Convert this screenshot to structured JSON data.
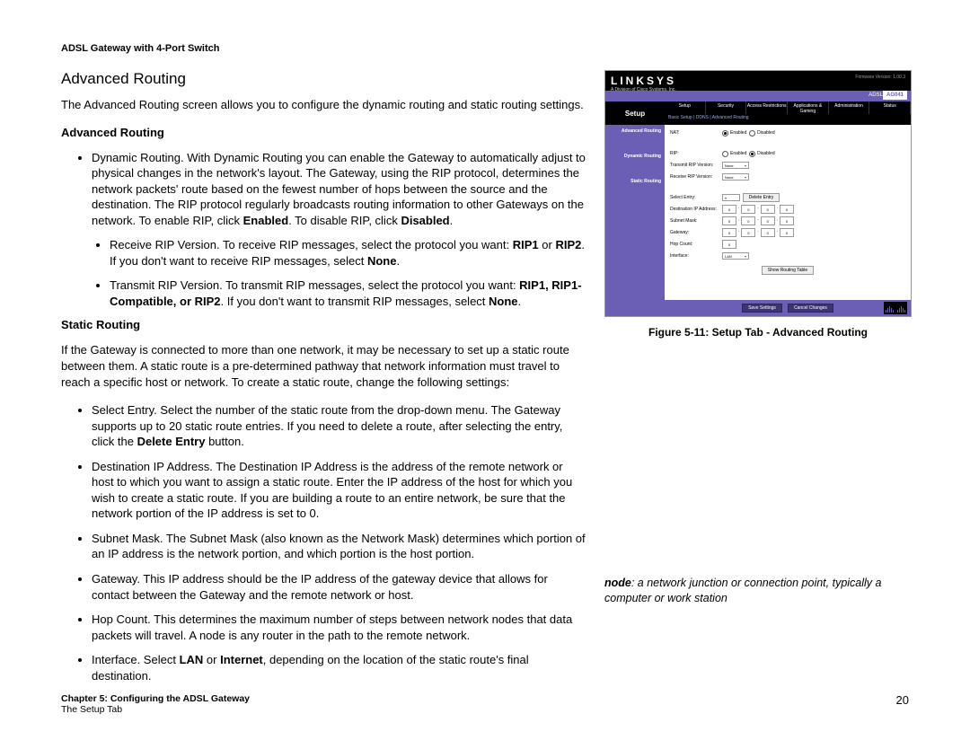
{
  "header": "ADSL Gateway with 4-Port Switch",
  "title": "Advanced Routing",
  "intro": "The Advanced Routing screen allows you to configure the dynamic routing and static routing settings.",
  "section1": {
    "heading": "Advanced Routing",
    "b1_pre": "Dynamic Routing. With Dynamic Routing you can enable the Gateway to automatically adjust to physical changes in the network's layout. The Gateway, using the RIP protocol, determines the network packets' route based on the fewest number of hops between the source and the destination. The RIP protocol regularly broadcasts routing information to other Gateways on the network. To enable RIP, click ",
    "b1_bold1": "Enabled",
    "b1_mid": ". To disable RIP, click ",
    "b1_bold2": "Disabled",
    "b1_end": ".",
    "b2_pre": "Receive RIP Version. To receive RIP messages, select the protocol you want: ",
    "b2_bold1": "RIP1",
    "b2_mid1": " or ",
    "b2_bold2": "RIP2",
    "b2_mid2": ". If you don't want to receive RIP messages, select ",
    "b2_bold3": "None",
    "b2_end": ".",
    "b3_pre": "Transmit RIP Version. To transmit RIP messages, select the protocol you want: ",
    "b3_bold1": "RIP1, RIP1-Compatible, or RIP2",
    "b3_mid": ". If you don't want to transmit RIP messages, select ",
    "b3_bold2": "None",
    "b3_end": "."
  },
  "section2": {
    "heading": "Static Routing",
    "intro": "If the Gateway is connected to more than one network, it may be necessary to set up a static route between them. A static route is a pre-determined pathway that network information must travel to reach a specific host or network. To create a static route, change the following settings:",
    "b1_pre": "Select Entry. Select the number of the static route from the drop-down menu. The Gateway supports up to 20 static route entries. If you need to delete a route, after selecting the entry, click the ",
    "b1_bold": "Delete Entry",
    "b1_end": " button.",
    "b2": "Destination IP Address. The Destination IP Address is the address of the remote network or host to which you want to assign a static route. Enter the IP address of the host for which you wish to create a static route. If you are building a route to an entire network, be sure that the network portion of the IP address is set to 0.",
    "b3": "Subnet Mask. The Subnet Mask (also known as the Network Mask) determines which portion of an IP address is the network portion, and which portion is the host portion.",
    "b4": "Gateway. This IP address should be the IP address of the gateway device that allows for contact between the Gateway and the remote network or host.",
    "b5": "Hop Count. This determines the maximum number of steps between network nodes that data packets will travel. A node is any router in the path to the remote network.",
    "b6_pre": "Interface. Select ",
    "b6_bold1": "LAN",
    "b6_mid": " or ",
    "b6_bold2": "Internet",
    "b6_end": ", depending on the location of the static route's final destination."
  },
  "figure": {
    "caption": "Figure 5-11: Setup Tab - Advanced Routing",
    "logo": "LINKSYS",
    "logo_sub": "A Division of Cisco Systems, Inc.",
    "fw": "Firmware Version: 1.00.3",
    "banner_text": "ADSL Gateway",
    "model": "AG041",
    "setup_label": "Setup",
    "tabs": [
      "Setup",
      "Security",
      "Access Restrictions",
      "Applications & Gaming",
      "Administration",
      "Status"
    ],
    "subtabs": "Basic Setup    |    DDNS    |    Advanced Routing",
    "side": {
      "s1": "Advanced Routing",
      "s2": "Dynamic Routing",
      "s3": "Static Routing"
    },
    "rows": {
      "nat": "NAT:",
      "enabled": "Enabled",
      "disabled": "Disabled",
      "rip": "RIP:",
      "tx": "Transmit RIP Version:",
      "rx": "Receive RIP Version:",
      "sel_none": "None",
      "select_entry": "Select Entry:",
      "delete": "Delete Entry",
      "dest": "Destination IP Address:",
      "mask": "Subnet Mask:",
      "gw": "Gateway:",
      "hop": "Hop Count:",
      "iface": "Interface:",
      "lan": "LAN",
      "show": "Show Routing Table",
      "save": "Save Settings",
      "cancel": "Cancel Changes",
      "zero": "0"
    }
  },
  "definition": {
    "term": "node",
    "text": ": a network junction or connection point, typically a computer or work station"
  },
  "footer": {
    "chapter": "Chapter 5: Configuring the ADSL Gateway",
    "section": "The Setup Tab",
    "page": "20"
  }
}
